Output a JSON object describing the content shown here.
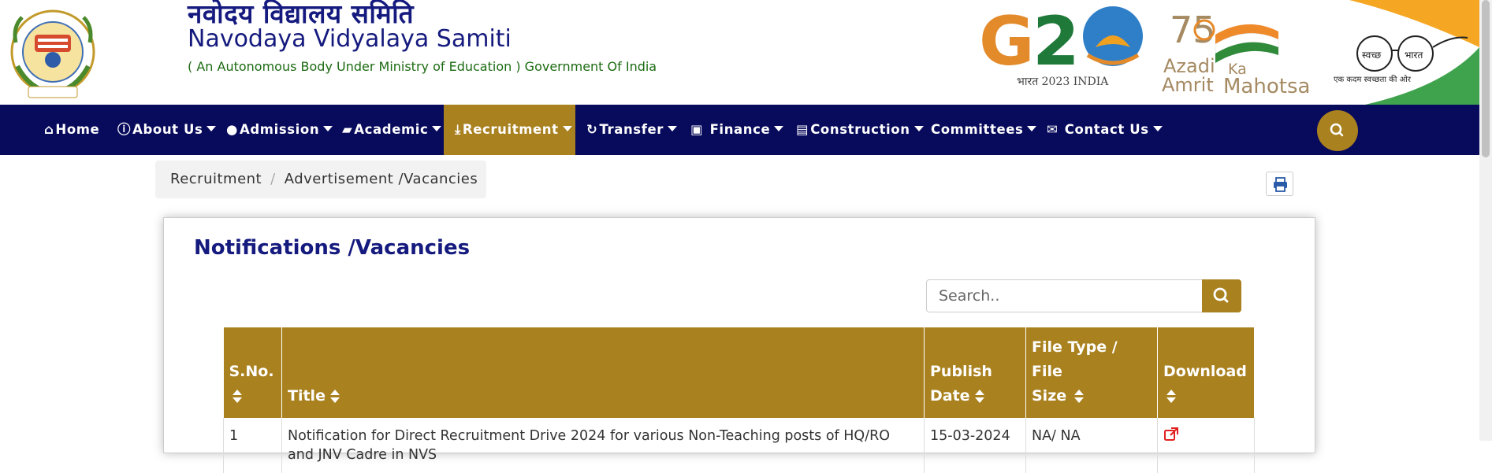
{
  "header": {
    "title_hindi": "नवोदय विद्यालय समिति",
    "title_en": "Navodaya Vidyalaya Samiti",
    "subtitle": "( An Autonomous Body Under Ministry of Education ) Government Of India",
    "logo_text": "नवोदय विद्यालय समिति प्रज्ञानम् ब्रह्म",
    "g20": {
      "mark": "G20",
      "caption": "भारत 2023 INDIA"
    },
    "azadi": {
      "line1": "Azadi",
      "ka": "Ka",
      "line2": "Amrit",
      "line3": "Mahotsav",
      "num": "75"
    },
    "swachh": {
      "word1": "स्वच्छ",
      "word2": "भारत",
      "tagline": "एक कदम स्वच्छता की ओर"
    }
  },
  "nav": {
    "items": [
      {
        "label": "Home",
        "icon": "home-icon",
        "glyph": "⌂",
        "dropdown": false
      },
      {
        "label": "About Us",
        "icon": "info-icon",
        "glyph": "ⓘ",
        "dropdown": true
      },
      {
        "label": "Admission",
        "icon": "user-icon",
        "glyph": "👤",
        "dropdown": true
      },
      {
        "label": "Academic",
        "icon": "book-icon",
        "glyph": "📘",
        "dropdown": true
      },
      {
        "label": "Recruitment",
        "icon": "download-icon",
        "glyph": "⤓",
        "dropdown": true,
        "active": true
      },
      {
        "label": "Transfer",
        "icon": "refresh-icon",
        "glyph": "↻",
        "dropdown": true
      },
      {
        "label": "Finance",
        "icon": "money-icon",
        "glyph": "💵",
        "dropdown": true
      },
      {
        "label": "Construction",
        "icon": "building-icon",
        "glyph": "🏢",
        "dropdown": true
      },
      {
        "label": "Committees",
        "icon": "",
        "glyph": "",
        "dropdown": true
      },
      {
        "label": "Contact Us",
        "icon": "envelope-icon",
        "glyph": "✉",
        "dropdown": true
      }
    ]
  },
  "breadcrumb": {
    "items": [
      "Recruitment",
      "Advertisement /Vacancies"
    ],
    "separator": "/"
  },
  "content": {
    "heading": "Notifications /Vacancies",
    "search_placeholder": "Search.."
  },
  "table": {
    "headers": [
      {
        "line1": "S.No.",
        "line2": ""
      },
      {
        "line1": "",
        "line2": "Title"
      },
      {
        "line1": "Publish",
        "line2": "Date"
      },
      {
        "line1": "File Type / File",
        "line2": "Size"
      },
      {
        "line1": "Download",
        "line2": ""
      }
    ],
    "rows": [
      {
        "sno": "1",
        "title": "Notification for Direct Recruitment Drive 2024 for various Non-Teaching posts of HQ/RO and JNV Cadre in NVS",
        "date": "15-03-2024",
        "filetype": "NA/ NA"
      }
    ]
  },
  "colors": {
    "navy": "#080a5c",
    "gold": "#a9811f",
    "title_blue": "#151a7e",
    "subtitle_green": "#1c6b12",
    "link_red": "#e02020"
  }
}
